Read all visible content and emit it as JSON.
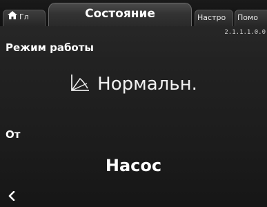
{
  "tabs": {
    "home_label": "Гл",
    "active_label": "Состояние",
    "settings_label": "Настро",
    "help_label": "Помо"
  },
  "version": "2.1.1.1.0.0",
  "operating_mode": {
    "label": "Режим работы",
    "value": "Нормальн.",
    "icon": "normal-mode-curve-icon"
  },
  "source": {
    "label": "От",
    "value": "Насос"
  },
  "navigation": {
    "back_icon": "chevron-left-icon"
  },
  "colors": {
    "background": "#222222",
    "text": "#ffffff",
    "tab_border": "#6a6a6a"
  }
}
